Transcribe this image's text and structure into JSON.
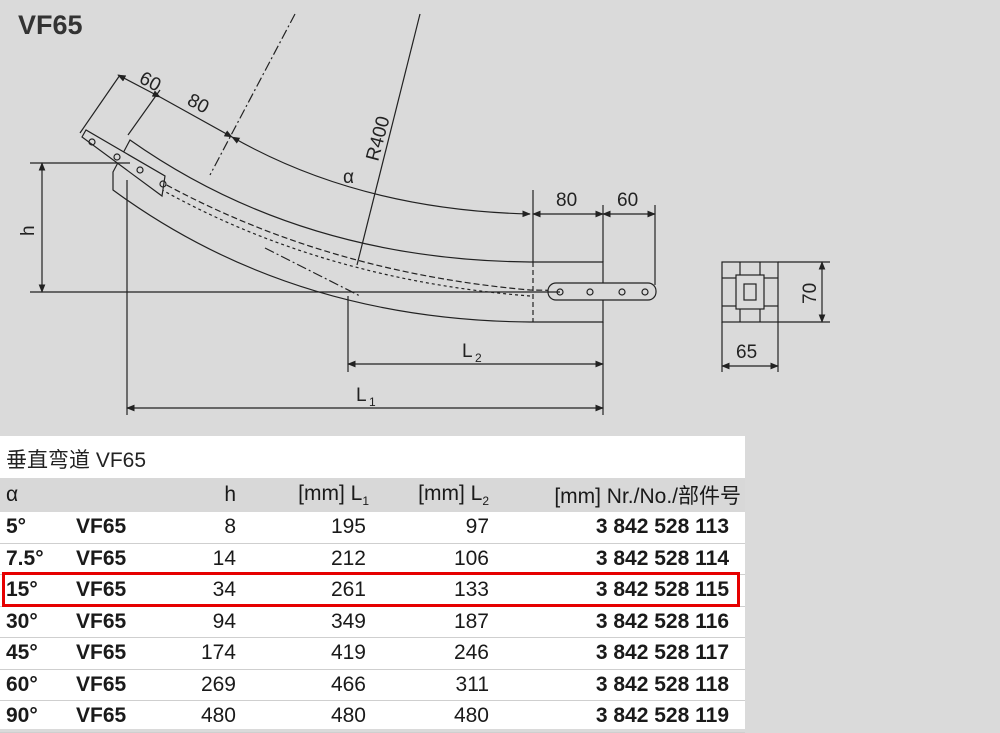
{
  "title": "VF65",
  "drawing": {
    "dim_60_top": "60",
    "dim_80_top": "80",
    "radius": "R400",
    "alpha": "α",
    "dim_80_right": "80",
    "dim_60_right": "60",
    "h_label": "h",
    "l2_label": "L",
    "l2_sub": "2",
    "l1_label": "L",
    "l1_sub": "1",
    "profile_height": "70",
    "profile_width": "65"
  },
  "table": {
    "caption": "垂直弯道 VF65",
    "headers": {
      "alpha": "α",
      "h": "h",
      "l1_unit": "[mm] L",
      "l1_sub": "1",
      "l2_unit": "[mm] L",
      "l2_sub": "2",
      "nr": "[mm] Nr./No./部件号"
    },
    "rows": [
      {
        "angle": "5°",
        "type": "VF65",
        "h": "8",
        "l1": "195",
        "l2": "97",
        "nr": "3 842 528 113"
      },
      {
        "angle": "7.5°",
        "type": "VF65",
        "h": "14",
        "l1": "212",
        "l2": "106",
        "nr": "3 842 528 114"
      },
      {
        "angle": "15°",
        "type": "VF65",
        "h": "34",
        "l1": "261",
        "l2": "133",
        "nr": "3 842 528 115"
      },
      {
        "angle": "30°",
        "type": "VF65",
        "h": "94",
        "l1": "349",
        "l2": "187",
        "nr": "3 842 528 116"
      },
      {
        "angle": "45°",
        "type": "VF65",
        "h": "174",
        "l1": "419",
        "l2": "246",
        "nr": "3 842 528 117"
      },
      {
        "angle": "60°",
        "type": "VF65",
        "h": "269",
        "l1": "466",
        "l2": "311",
        "nr": "3 842 528 118"
      },
      {
        "angle": "90°",
        "type": "VF65",
        "h": "480",
        "l1": "480",
        "l2": "480",
        "nr": "3 842 528 119"
      }
    ],
    "highlighted_row": 2,
    "highlight_color": "#e60000"
  }
}
